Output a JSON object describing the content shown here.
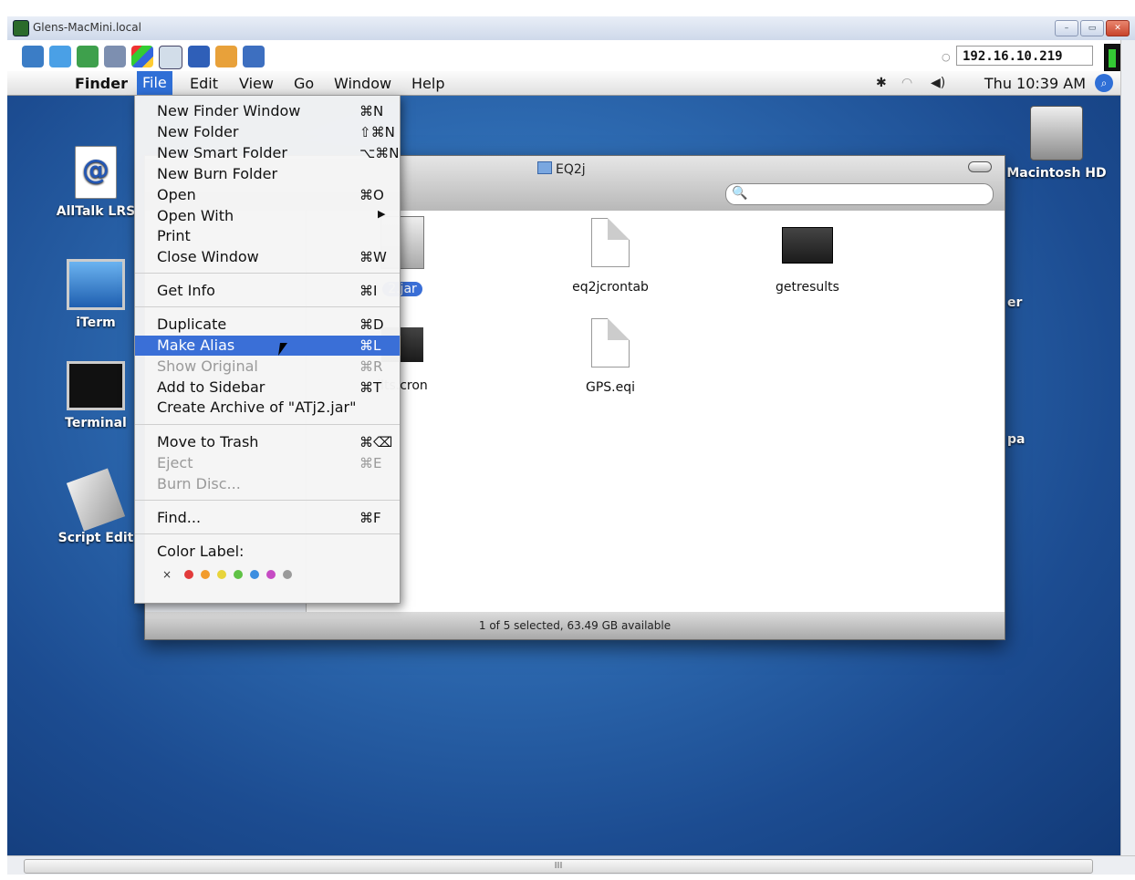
{
  "vnc": {
    "window_title": "Glens-MacMini.local",
    "host": "192.16.10.219",
    "scroll_grip": "III",
    "window_buttons": [
      "–",
      "▭",
      "✕"
    ],
    "toolbar_icons": [
      "network-icon",
      "screen-icon",
      "globe-icon",
      "refresh-icon",
      "windows-icon",
      "keyboard-icon",
      "file-transfer-icon",
      "chat-icon",
      "disconnect-icon"
    ]
  },
  "menubar": {
    "app": "Finder",
    "items": [
      "File",
      "Edit",
      "View",
      "Go",
      "Window",
      "Help"
    ],
    "clock": "Thu 10:39 AM"
  },
  "desktop_icons": [
    "AllTalk LRS",
    "iTerm",
    "Terminal",
    "Script Edit",
    "Macintosh HD"
  ],
  "finder": {
    "title": "EQ2j",
    "items": [
      {
        "name": "2.jar",
        "selected": true
      },
      {
        "name": "eq2jcrontab"
      },
      {
        "name": "getresults"
      },
      {
        "name": "ilts.cron"
      },
      {
        "name": "GPS.eqi"
      }
    ],
    "status": "1 of 5 selected, 63.49 GB available",
    "partial_right_labels": [
      "er",
      "pa"
    ]
  },
  "file_menu": {
    "items": [
      {
        "label": "New Finder Window",
        "shortcut": "⌘N"
      },
      {
        "label": "New Folder",
        "shortcut": "⇧⌘N"
      },
      {
        "label": "New Smart Folder",
        "shortcut": "⌥⌘N"
      },
      {
        "label": "New Burn Folder",
        "shortcut": ""
      },
      {
        "label": "Open",
        "shortcut": "⌘O"
      },
      {
        "label": "Open With",
        "shortcut": "▶"
      },
      {
        "label": "Print",
        "shortcut": ""
      },
      {
        "label": "Close Window",
        "shortcut": "⌘W"
      },
      {
        "label": "Get Info",
        "shortcut": "⌘I"
      },
      {
        "label": "Duplicate",
        "shortcut": "⌘D"
      },
      {
        "label": "Make Alias",
        "shortcut": "⌘L",
        "highlighted": true
      },
      {
        "label": "Show Original",
        "shortcut": "⌘R",
        "disabled": true
      },
      {
        "label": "Add to Sidebar",
        "shortcut": "⌘T"
      },
      {
        "label": "Create Archive of \"ATj2.jar\"",
        "shortcut": ""
      },
      {
        "label": "Move to Trash",
        "shortcut": "⌘⌫"
      },
      {
        "label": "Eject",
        "shortcut": "⌘E",
        "disabled": true
      },
      {
        "label": "Burn Disc...",
        "shortcut": "",
        "disabled": true
      },
      {
        "label": "Find...",
        "shortcut": "⌘F"
      },
      {
        "label": "Color Label:",
        "shortcut": ""
      }
    ],
    "color_labels": [
      "#e23b3b",
      "#f29b2b",
      "#e8d43a",
      "#5fc245",
      "#3c8ee0",
      "#c64bc4",
      "#9a9a9a"
    ],
    "color_none": "×"
  }
}
